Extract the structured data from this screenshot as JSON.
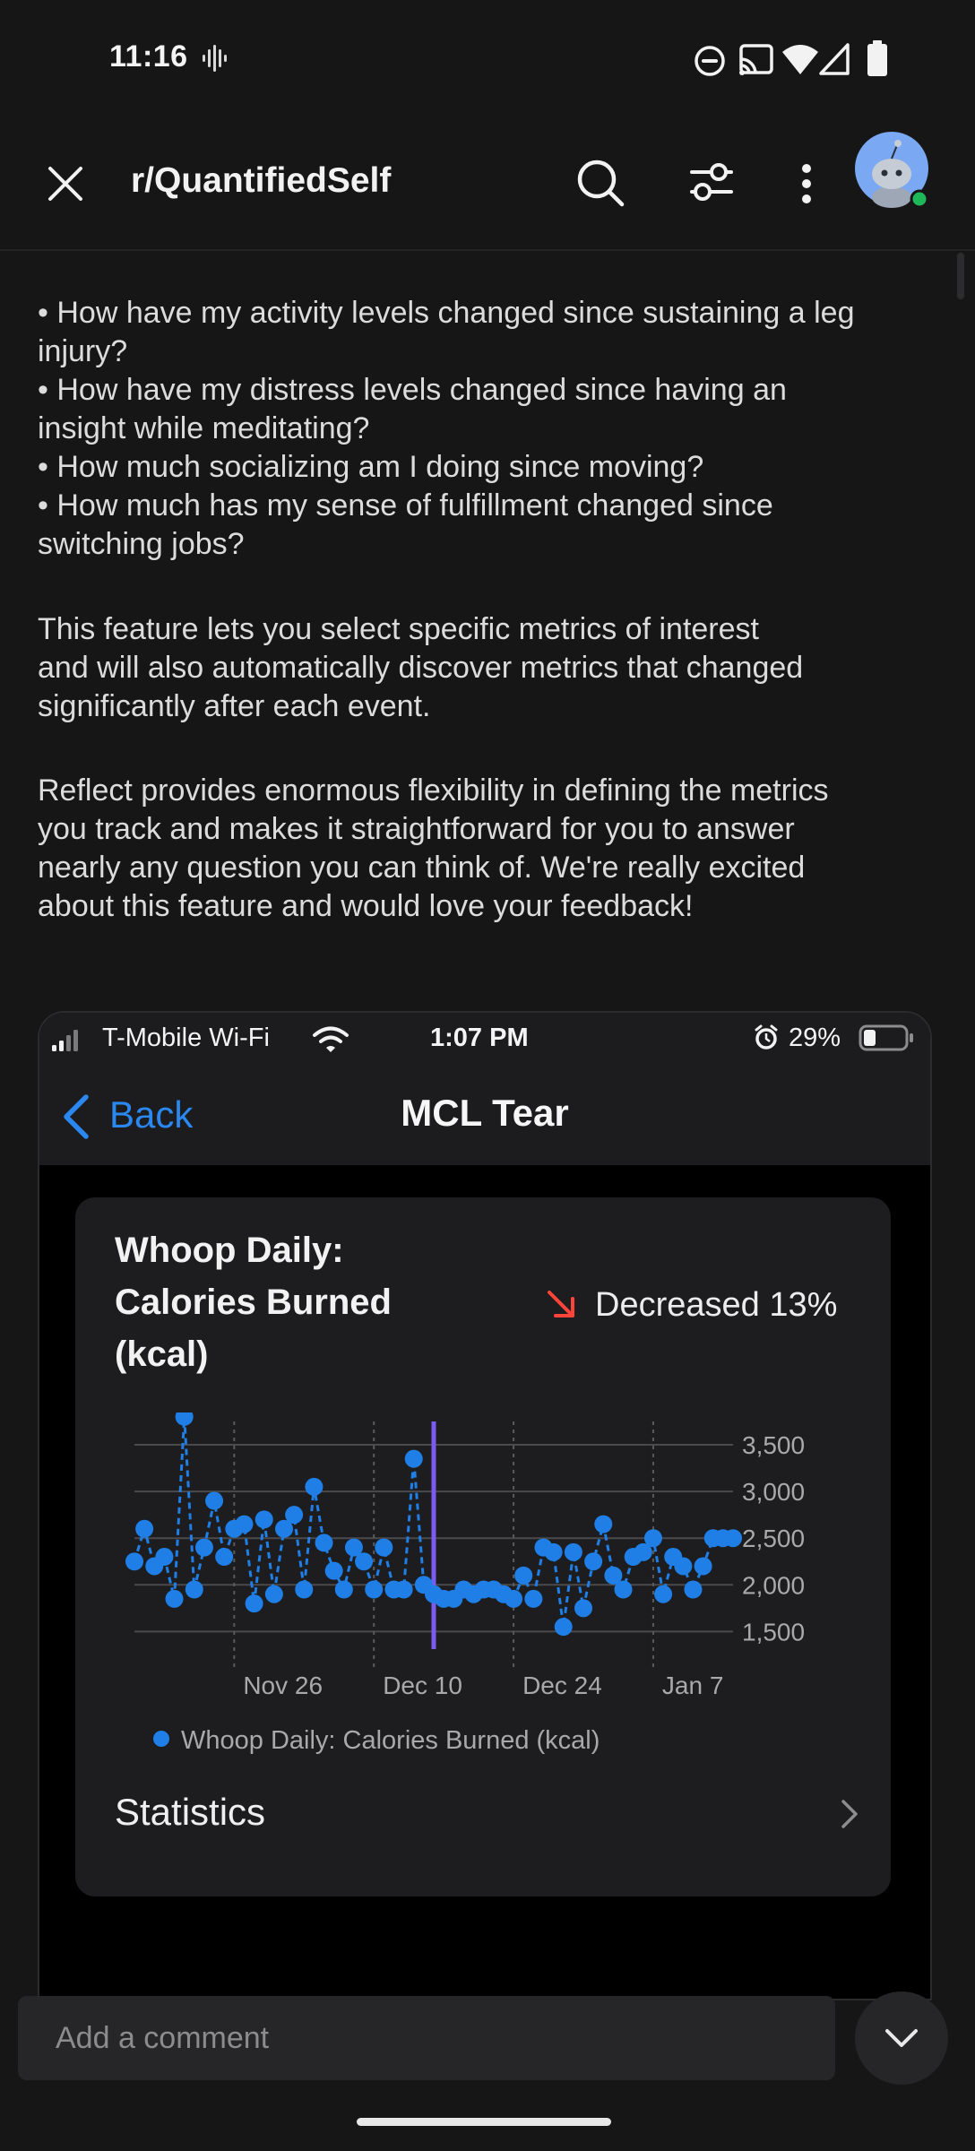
{
  "status_bar": {
    "time": "11:16",
    "icons": [
      "voice-activity-icon",
      "dnd-icon",
      "cast-icon",
      "wifi-icon",
      "cell-signal-icon",
      "battery-icon"
    ]
  },
  "header": {
    "close_icon": "close-icon",
    "subreddit": "r/QuantifiedSelf",
    "icons": [
      "search-icon",
      "filter-icon",
      "more-vert-icon",
      "avatar"
    ],
    "online_color": "#1eb85b"
  },
  "post": {
    "bullets": [
      [
        "• How have my activity levels changed since sustaining a leg",
        "injury?"
      ],
      [
        "• How have my distress levels changed since having an",
        "insight while meditating?"
      ],
      [
        "• How much socializing am I doing since moving?"
      ],
      [
        "• How much has my sense of fulfillment changed since",
        "switching jobs?"
      ]
    ],
    "paragraph_1": [
      "This feature lets you select specific metrics of interest",
      "and will also automatically discover metrics that changed",
      "significantly after each event."
    ],
    "paragraph_2": [
      "Reflect provides enormous flexibility in defining the metrics",
      "you track and makes it straightforward for you to answer",
      "nearly any question you can think of. We're really excited",
      "about this feature and would love your feedback!"
    ]
  },
  "embedded_screenshot": {
    "status": {
      "carrier": "T-Mobile Wi-Fi",
      "time": "1:07 PM",
      "battery": "29%"
    },
    "nav": {
      "back_label": "Back",
      "title": "MCL Tear"
    },
    "card": {
      "title_lines": [
        "Whoop Daily:",
        "Calories Burned",
        "(kcal)"
      ],
      "change_text": "Decreased 13%",
      "change_color": "#ff453a",
      "statistics_label": "Statistics"
    }
  },
  "chart_data": {
    "type": "scatter",
    "x_tick_labels": [
      "Nov 26",
      "Dec 10",
      "Dec 24",
      "Jan 7"
    ],
    "y_ticks": [
      1500,
      2000,
      2500,
      3000,
      3500
    ],
    "y_tick_labels": [
      "1,500",
      "2,000",
      "2,500",
      "3,000",
      "3,500"
    ],
    "ylim": [
      1350,
      3750
    ],
    "day_range": [
      0,
      60
    ],
    "event_day": 30,
    "event_color": "#7b5cf0",
    "series": [
      {
        "name": "Whoop Daily: Calories Burned (kcal)",
        "color": "#1f7fe6",
        "x": [
          0,
          1,
          2,
          3,
          4,
          5,
          6,
          7,
          8,
          9,
          10,
          11,
          12,
          13,
          14,
          15,
          16,
          17,
          18,
          19,
          20,
          21,
          22,
          23,
          24,
          25,
          26,
          27,
          28,
          29,
          30,
          31,
          32,
          33,
          34,
          35,
          36,
          37,
          38,
          39,
          40,
          41,
          42,
          43,
          44,
          45,
          46,
          47,
          48,
          49,
          50,
          51,
          52,
          53,
          54,
          55,
          56,
          57,
          58,
          59,
          60
        ],
        "values": [
          2250,
          2600,
          2200,
          2300,
          1850,
          3800,
          1950,
          2400,
          2900,
          2300,
          2600,
          2650,
          1800,
          2700,
          1900,
          2600,
          2750,
          1950,
          3050,
          2450,
          2150,
          1950,
          2400,
          2250,
          1950,
          2400,
          1950,
          1950,
          3350,
          2000,
          1900,
          1850,
          1850,
          1950,
          1900,
          1950,
          1950,
          1900,
          1850,
          2100,
          1850,
          2400,
          2350,
          1550,
          2350,
          1750,
          2250,
          2650,
          2100,
          1950,
          2300,
          2350,
          2500,
          1900,
          2300,
          2200,
          1950,
          2200,
          2500,
          2500,
          2500
        ]
      }
    ],
    "legend": "bottom-left"
  },
  "comment_bar": {
    "placeholder": "Add a comment",
    "collapse_icon": "chevron-down-icon"
  }
}
